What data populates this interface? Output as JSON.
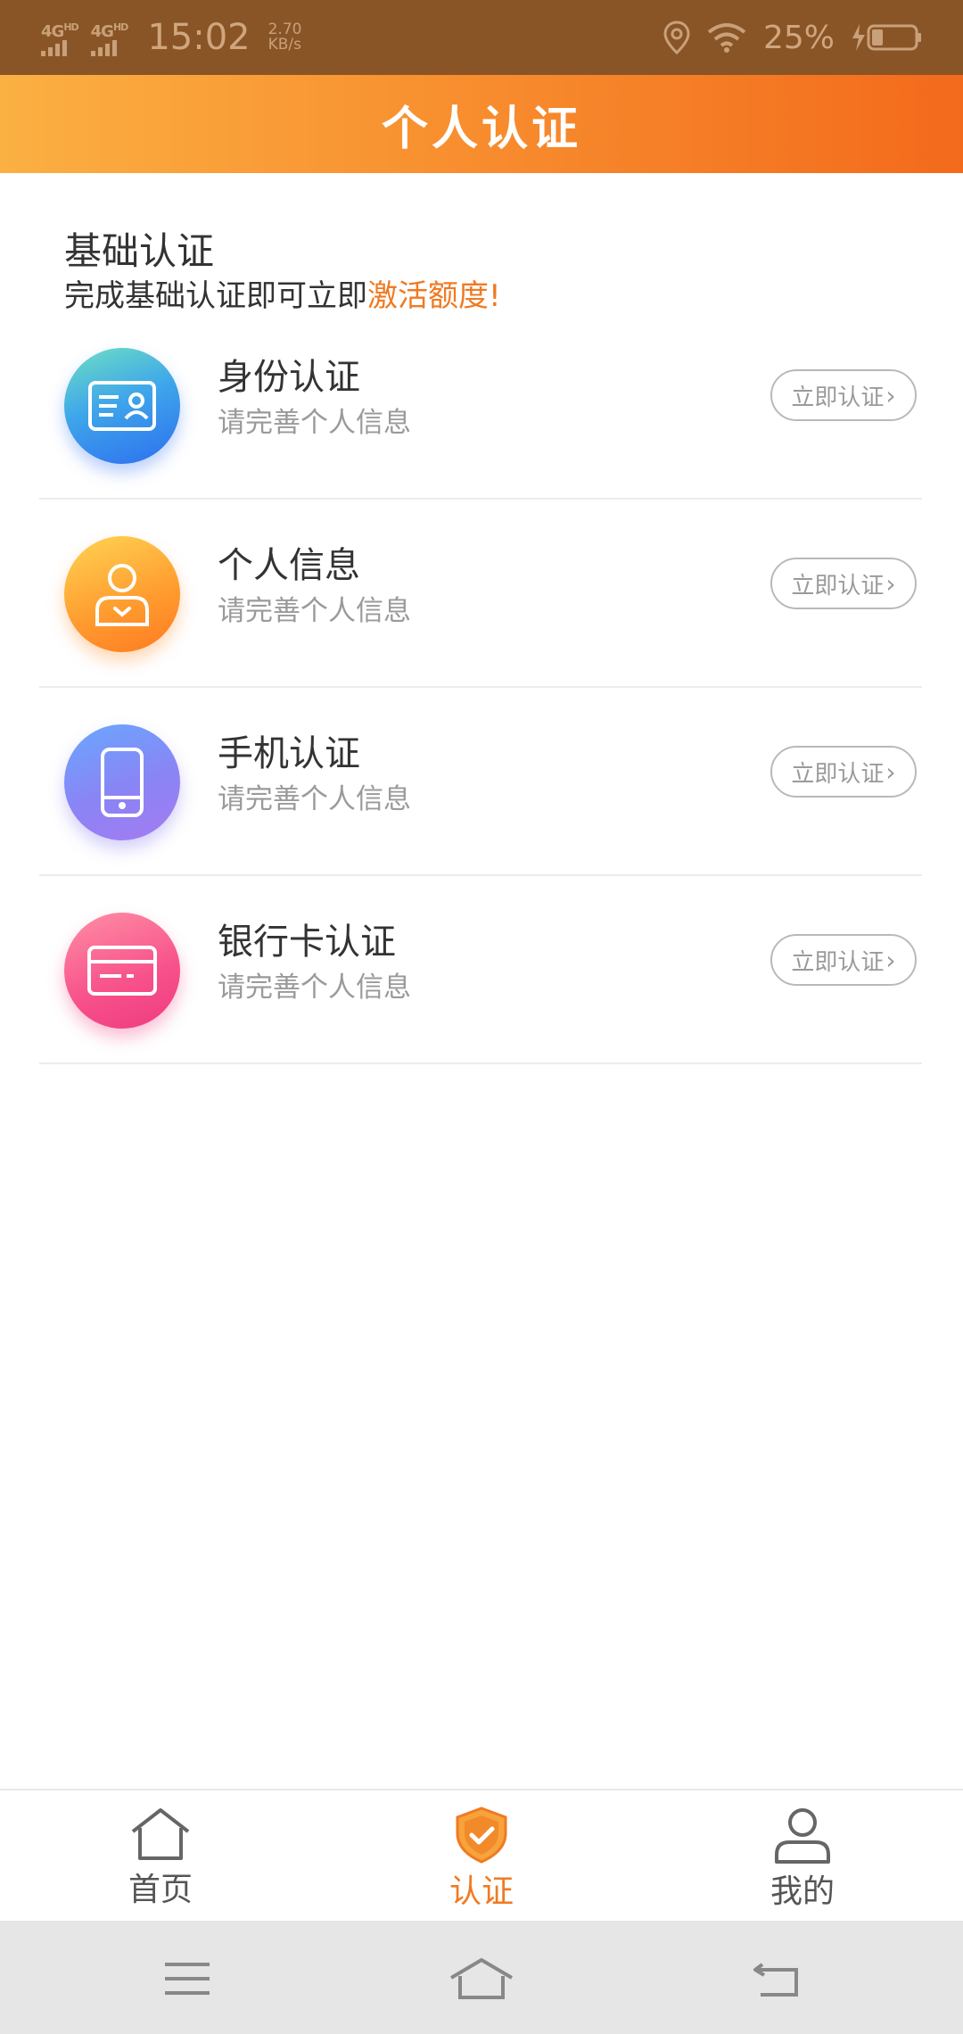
{
  "status_bar": {
    "network1": "4G",
    "network1_sup": "HD",
    "network2": "4G",
    "network2_sup": "HD",
    "time": "15:02",
    "speed_value": "2.70",
    "speed_unit": "KB/s",
    "battery_percent": "25%"
  },
  "header": {
    "title": "个人认证"
  },
  "intro": {
    "title": "基础认证",
    "subtitle_prefix": "完成基础认证即可立即",
    "subtitle_highlight": "激活额度!"
  },
  "items": [
    {
      "title": "身份认证",
      "subtitle": "请完善个人信息",
      "button": "立即认证",
      "icon": "id-card-icon"
    },
    {
      "title": "个人信息",
      "subtitle": "请完善个人信息",
      "button": "立即认证",
      "icon": "person-icon"
    },
    {
      "title": "手机认证",
      "subtitle": "请完善个人信息",
      "button": "立即认证",
      "icon": "phone-icon"
    },
    {
      "title": "银行卡认证",
      "subtitle": "请完善个人信息",
      "button": "立即认证",
      "icon": "bank-card-icon"
    }
  ],
  "tabbar": {
    "tabs": [
      {
        "label": "首页",
        "icon": "home-icon",
        "active": false
      },
      {
        "label": "认证",
        "icon": "shield-check-icon",
        "active": true
      },
      {
        "label": "我的",
        "icon": "user-icon",
        "active": false
      }
    ]
  },
  "colors": {
    "accent": "#f07a22",
    "header_start": "#fbb042",
    "header_end": "#f36a1c",
    "status_bar": "#8a5526"
  },
  "system_nav": {
    "buttons": [
      "menu-icon",
      "home-outline-icon",
      "back-icon"
    ]
  }
}
